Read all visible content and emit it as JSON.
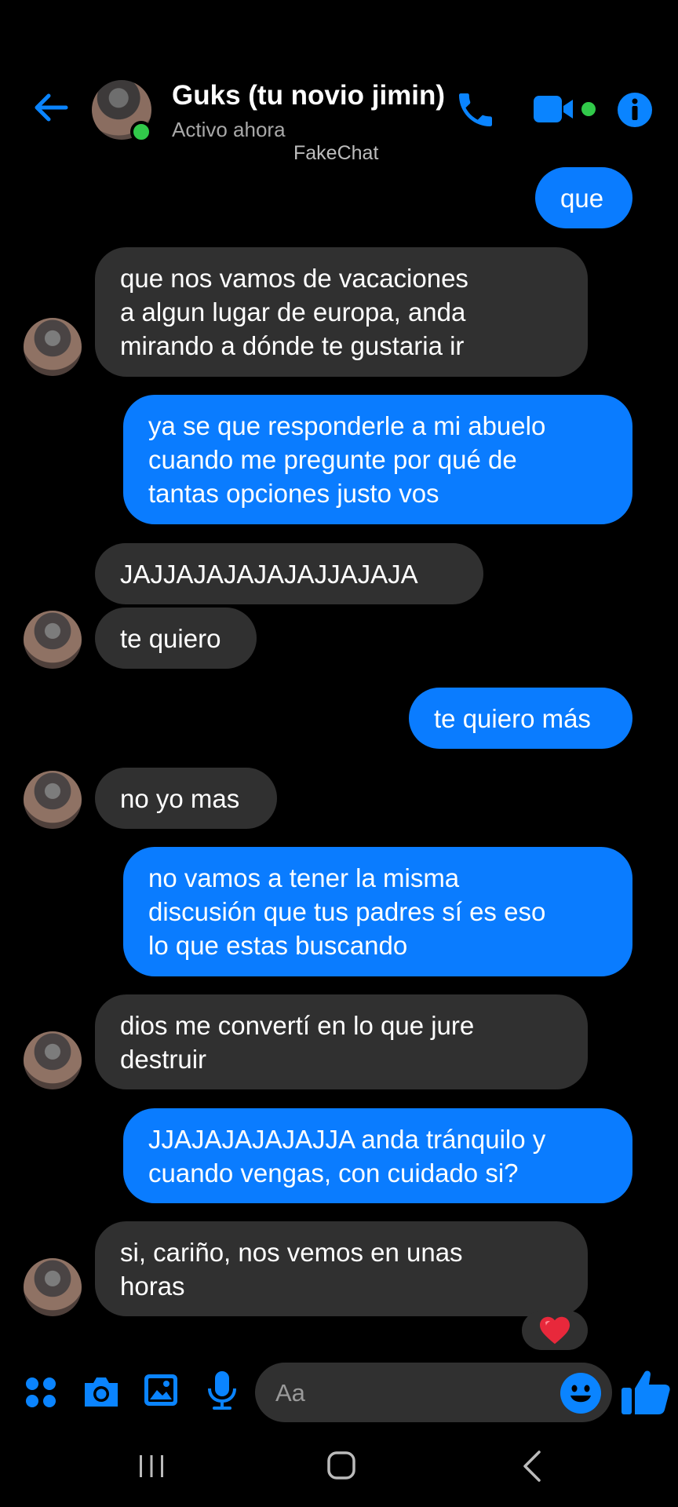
{
  "header": {
    "contact_name": "Guks (tu novio jimin)",
    "status": "Activo ahora",
    "watermark": "FakeChat",
    "icons": [
      "back-arrow-icon",
      "phone-icon",
      "video-camera-icon",
      "info-icon"
    ]
  },
  "messages": [
    {
      "direction": "out",
      "lines": [
        "que"
      ]
    },
    {
      "direction": "in",
      "lines": [
        "que nos vamos de vacaciones",
        "a algun lugar de europa, anda",
        "mirando a dónde te gustaria ir"
      ]
    },
    {
      "direction": "out",
      "lines": [
        "ya se que responderle a mi abuelo",
        "cuando me pregunte por qué de",
        "tantas opciones justo vos"
      ]
    },
    {
      "direction": "in",
      "lines": [
        "JAJJAJAJAJAJAJJAJAJA"
      ]
    },
    {
      "direction": "in",
      "lines": [
        "te quiero"
      ]
    },
    {
      "direction": "out",
      "lines": [
        "te quiero más"
      ]
    },
    {
      "direction": "in",
      "lines": [
        "no yo mas"
      ]
    },
    {
      "direction": "out",
      "lines": [
        "no vamos a tener la misma",
        "discusión que tus padres sí es eso",
        "lo que estas buscando"
      ]
    },
    {
      "direction": "in",
      "lines": [
        "dios me convertí en lo que jure",
        "destruir"
      ]
    },
    {
      "direction": "out",
      "lines": [
        "JJAJAJAJAJAJJA anda tránquilo y",
        "cuando vengas, con cuidado si?"
      ]
    },
    {
      "direction": "in",
      "lines": [
        "si, cariño, nos vemos en unas",
        "horas"
      ]
    }
  ],
  "reaction": {
    "emoji": "heart",
    "color": "#e8283b"
  },
  "composer": {
    "placeholder": "Aa",
    "icons": [
      "apps-grid-icon",
      "camera-icon",
      "gallery-icon",
      "microphone-icon",
      "emoji-icon",
      "thumbs-up-icon"
    ]
  },
  "nav_bar": {
    "icons": [
      "recent-apps-icon",
      "home-icon",
      "back-icon"
    ]
  },
  "colors": {
    "accent": "#0a7cff",
    "incoming_bubble": "#303030",
    "online": "#31c94a",
    "background": "#000000"
  }
}
